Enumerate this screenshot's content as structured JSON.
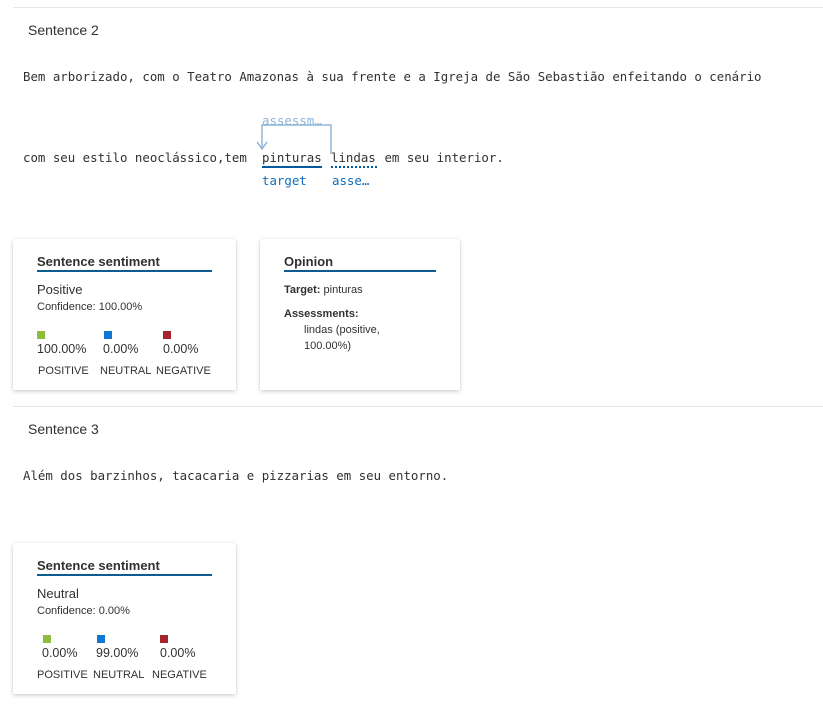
{
  "colors": {
    "positive": "#8dbb3c",
    "neutral": "#0f78d4",
    "negative": "#a4262c",
    "accent": "#005a9e"
  },
  "sentences": [
    {
      "title": "Sentence 2",
      "line1": "Bem arborizado, com o Teatro Amazonas à sua frente e a Igreja de São Sebastião enfeitando o cenário",
      "line2_prefix": "com seu estilo neoclássico,tem ",
      "target_word": "pinturas",
      "assessment_word": "lindas",
      "line2_suffix": " em seu interior.",
      "relation_label": "assessm…",
      "target_tag": "target",
      "assessment_tag": "asse…",
      "sentiment_card": {
        "heading": "Sentence sentiment",
        "label": "Positive",
        "confidence": "Confidence: 100.00%",
        "scores": [
          "100.00%",
          "0.00%",
          "0.00%"
        ],
        "categories": [
          "POSITIVE",
          "NEUTRAL",
          "NEGATIVE"
        ]
      },
      "opinion_card": {
        "heading": "Opinion",
        "target_label": "Target:",
        "target_value": "pinturas",
        "assessments_label": "Assessments:",
        "assessment_line1": "lindas (positive,",
        "assessment_line2": "100.00%)"
      }
    },
    {
      "title": "Sentence 3",
      "line1": "Além dos barzinhos, tacacaria e pizzarias em seu entorno.",
      "sentiment_card": {
        "heading": "Sentence sentiment",
        "label": "Neutral",
        "confidence": "Confidence: 0.00%",
        "scores": [
          "0.00%",
          "99.00%",
          "0.00%"
        ],
        "categories": [
          "POSITIVE",
          "NEUTRAL",
          "NEGATIVE"
        ]
      }
    }
  ]
}
